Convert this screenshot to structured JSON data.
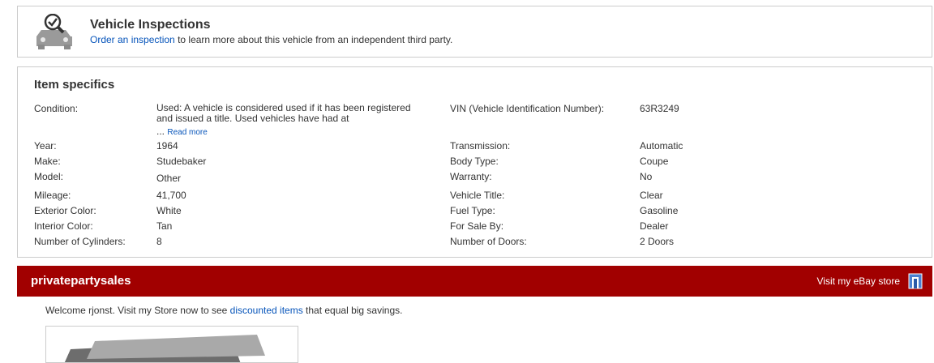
{
  "inspection": {
    "title": "Vehicle Inspections",
    "link_text": "Order an inspection",
    "text": " to learn more about this vehicle from an independent third party."
  },
  "specifics": {
    "title": "Item specifics",
    "condition_label": "Condition:",
    "condition_text": "Used: A vehicle is considered used if it has been registered and issued a title. Used vehicles have had at",
    "ellipsis": "...",
    "read_more": "Read more",
    "left": [
      {
        "label": "Year:",
        "value": "1964"
      },
      {
        "label": "Make:",
        "value": "Studebaker"
      },
      {
        "label": "Model:",
        "value": "Other"
      },
      {
        "label": "Mileage:",
        "value": "41,700"
      },
      {
        "label": "Exterior Color:",
        "value": "White"
      },
      {
        "label": "Interior Color:",
        "value": "Tan"
      },
      {
        "label": "Number of Cylinders:",
        "value": "8"
      }
    ],
    "right": [
      {
        "label": "VIN (Vehicle Identification Number):",
        "value": "63R3249"
      },
      {
        "label": "Transmission:",
        "value": "Automatic"
      },
      {
        "label": "Body Type:",
        "value": "Coupe"
      },
      {
        "label": "Warranty:",
        "value": "No"
      },
      {
        "label": "Vehicle Title:",
        "value": "Clear"
      },
      {
        "label": "Fuel Type:",
        "value": "Gasoline"
      },
      {
        "label": "For Sale By:",
        "value": "Dealer"
      },
      {
        "label": "Number of Doors:",
        "value": "2 Doors"
      }
    ]
  },
  "store": {
    "name": "privatepartysales",
    "visit_label": "Visit my eBay store",
    "bar_color": "#a10000",
    "welcome_prefix": "Welcome rjonst. Visit my Store now to see ",
    "welcome_link": "discounted items",
    "welcome_suffix": " that equal big savings."
  }
}
